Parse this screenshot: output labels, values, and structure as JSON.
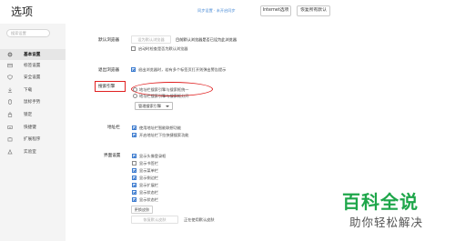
{
  "window": {
    "title": "选项",
    "sync_link": "同步设置 · 未开启同步",
    "internet_options_button": "Internet选项",
    "reset_button": "恢复所有默认"
  },
  "sidebar": {
    "search_placeholder": "搜索设置",
    "items": [
      {
        "label": "基本设置",
        "icon": "gear-icon",
        "active": true
      },
      {
        "label": "标签设置",
        "icon": "tab-icon",
        "active": false
      },
      {
        "label": "安全设置",
        "icon": "shield-icon",
        "active": false
      },
      {
        "label": "下载",
        "icon": "download-icon",
        "active": false
      },
      {
        "label": "鼠标手势",
        "icon": "mouse-icon",
        "active": false
      },
      {
        "label": "锁定",
        "icon": "lock-icon",
        "active": false
      },
      {
        "label": "快捷键",
        "icon": "keyboard-icon",
        "active": false
      },
      {
        "label": "扩展程序",
        "icon": "puzzle-icon",
        "active": false
      },
      {
        "label": "实验室",
        "icon": "flask-icon",
        "active": false
      }
    ]
  },
  "main": {
    "default_browser": {
      "label": "默认浏览器",
      "button": "设为默认浏览器",
      "status": "目前默认浏览器是否已设为此浏览器",
      "checkbox": "启动时检查是否为默认浏览器"
    },
    "exit_browser": {
      "label": "退出浏览器",
      "checkbox": "退出浏览器时，若有多个标签页打开则弹出警告提示"
    },
    "search_engine": {
      "label": "搜索引擎",
      "option1": "地址栏搜索引擎与搜索框统一",
      "option2": "地址栏搜索引擎与搜索框分开",
      "select_value": "管理搜索引擎"
    },
    "address_bar": {
      "label": "地址栏",
      "checkbox1": "使用地址栏智能联想功能",
      "checkbox2": "开启地址栏下拉快捷搜索功能"
    },
    "appearance": {
      "label": "界面设置",
      "items": [
        {
          "label": "显示头像登录框",
          "checked": true
        },
        {
          "label": "显示书签栏",
          "checked": false
        },
        {
          "label": "显示菜单栏",
          "checked": true
        },
        {
          "label": "显示侧边栏",
          "checked": true
        },
        {
          "label": "显示扩展栏",
          "checked": true
        },
        {
          "label": "显示状态栏",
          "checked": true
        },
        {
          "label": "显示状态栏",
          "checked": true
        }
      ],
      "skin_button": "更换皮肤",
      "restore_button": "恢复默认皮肤",
      "restore_status": "正在使用默认皮肤"
    }
  },
  "watermark": {
    "line1": "百科全说",
    "line2": "助你轻松解决"
  },
  "colors": {
    "accent": "#3b7bd0",
    "highlight": "#e02020",
    "watermark_green": "#1ea64a",
    "sidebar_bg": "#f4f4f4"
  }
}
